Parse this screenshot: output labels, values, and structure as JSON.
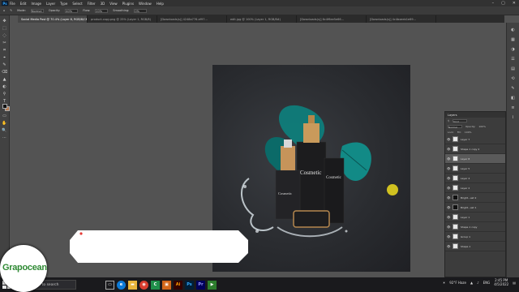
{
  "app": {
    "logo": "Ps",
    "menu": [
      "File",
      "Edit",
      "Image",
      "Layer",
      "Type",
      "Select",
      "Filter",
      "3D",
      "View",
      "Plugins",
      "Window",
      "Help"
    ]
  },
  "options": {
    "mode_label": "Mode:",
    "mode_value": "Normal",
    "opacity_label": "Opacity:",
    "opacity_value": "40%",
    "flow_label": "Flow:",
    "flow_value": "20%",
    "smoothing_label": "Smoothing:",
    "smoothing_value": "0%"
  },
  "tabs": [
    {
      "label": "Social Media Post @ 70.4% (Layer 8, RGB/8/CMYK) *"
    },
    {
      "label": "product-copy.png @ 25% (Layer 1, RGB/8)"
    },
    {
      "label": "[Downloads(s)] 4248a776-ef97..."
    },
    {
      "label": "edit.jpg @ 100% (Layer 1, RGB/8#)"
    },
    {
      "label": "[Downloads(s)] 6c4f6ee5e66..."
    },
    {
      "label": "[Downloads(s)] 4c4bxeeb1e69..."
    }
  ],
  "tools": [
    "✥",
    "⬚",
    "◌",
    "✂",
    "⌗",
    "⌖",
    "✎",
    "⌫",
    "▲",
    "◐",
    "⚲",
    "T",
    "↖",
    "▭",
    "✋",
    "🔍",
    "⋯"
  ],
  "layers_panel": {
    "title": "Layers",
    "kind_label": "Kind",
    "blend": "Normal",
    "opacity_label": "Opacity:",
    "opacity_value": "100%",
    "lock_label": "Lock:",
    "fill_label": "Fill:",
    "fill_value": "100%",
    "layers": [
      {
        "name": "Layer 7",
        "thumb": "light",
        "selected": false
      },
      {
        "name": "Shape 1 copy 2",
        "thumb": "light",
        "selected": false
      },
      {
        "name": "Layer 8",
        "thumb": "light",
        "selected": true
      },
      {
        "name": "Layer 5",
        "thumb": "light",
        "selected": false
      },
      {
        "name": "Layer 4",
        "thumb": "light",
        "selected": false
      },
      {
        "name": "Layer 2",
        "thumb": "light",
        "selected": false
      },
      {
        "name": "Bright...ast 2",
        "thumb": "dark",
        "selected": false
      },
      {
        "name": "Bright...ast 1",
        "thumb": "dark",
        "selected": false
      },
      {
        "name": "Layer 1",
        "thumb": "light",
        "selected": false
      },
      {
        "name": "Shape 1 copy",
        "thumb": "light",
        "selected": false
      },
      {
        "name": "Group 1",
        "thumb": "light",
        "selected": false
      },
      {
        "name": "Shape 1",
        "thumb": "light",
        "selected": false
      }
    ]
  },
  "product": {
    "bottle_label": "Cosmetic",
    "tube_label": "Cosmetic"
  },
  "taskbar": {
    "search_placeholder": "Type here to search",
    "weather": "92°F Haze",
    "lang": "ENG",
    "time": "2:45 PM",
    "date": "4/5/2022"
  },
  "brand_badge": {
    "name": "Grapocean",
    "tagline": ""
  },
  "colors": {
    "accent_leaf": "#0f7d7a",
    "cursor": "#e2d21f",
    "brand_green": "#2f8a34"
  }
}
